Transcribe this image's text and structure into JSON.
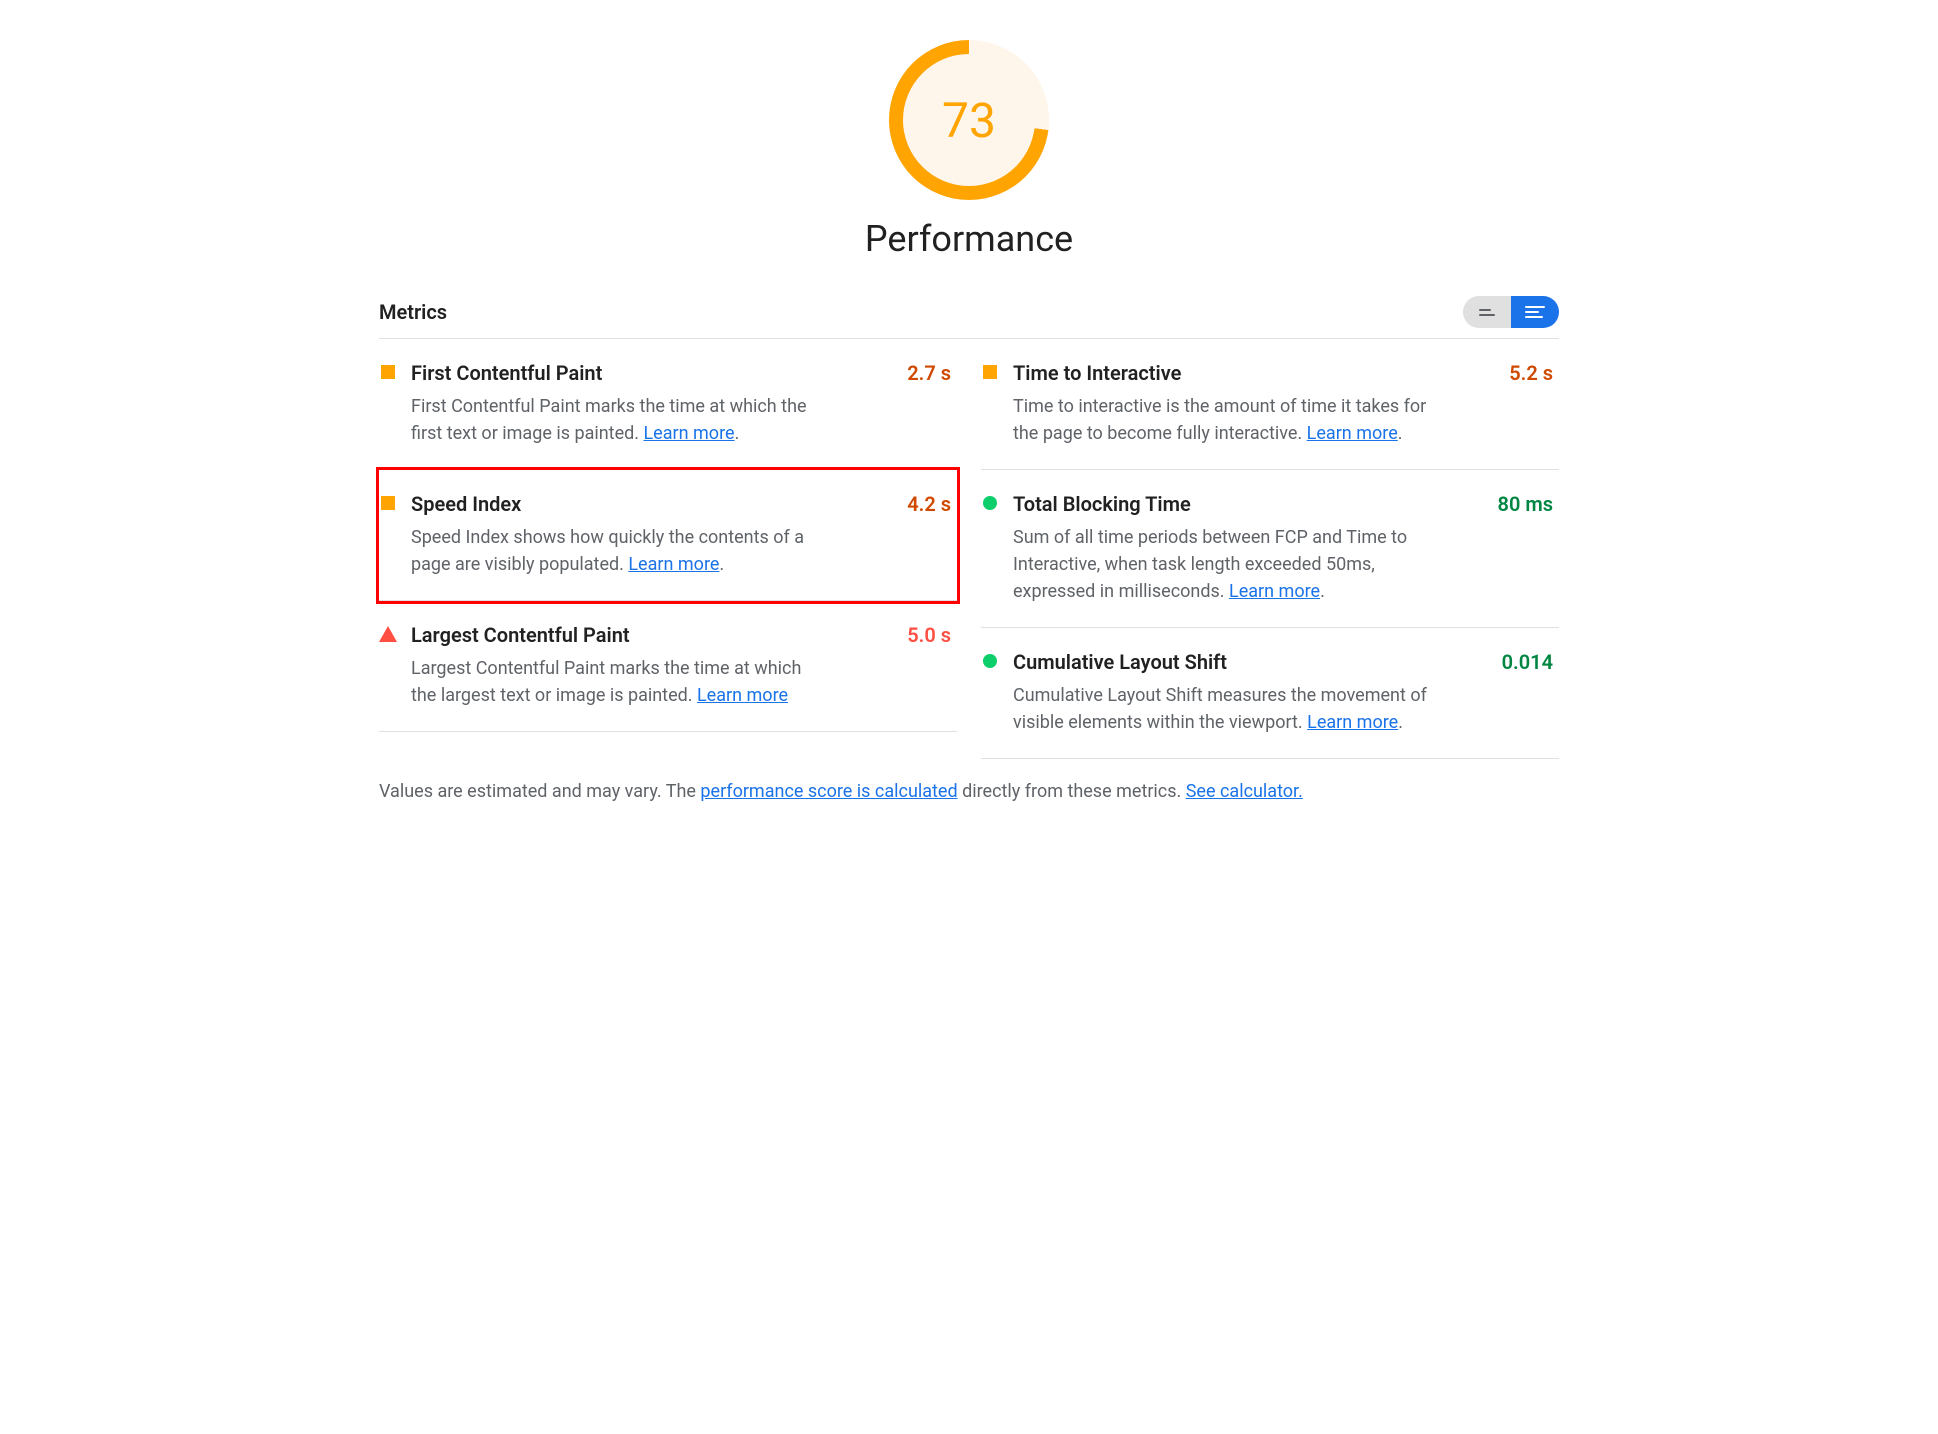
{
  "gauge": {
    "score": "73",
    "label": "Performance"
  },
  "sectionTitle": "Metrics",
  "metrics": {
    "left": [
      {
        "status": "average",
        "name": "First Contentful Paint",
        "value": "2.7 s",
        "valueClass": "v-orange",
        "desc": "First Contentful Paint marks the time at which the first text or image is painted. ",
        "learn": "Learn more",
        "afterLink": ".",
        "highlighted": false
      },
      {
        "status": "average",
        "name": "Speed Index",
        "value": "4.2 s",
        "valueClass": "v-orange",
        "desc": "Speed Index shows how quickly the contents of a page are visibly populated. ",
        "learn": "Learn more",
        "afterLink": ".",
        "highlighted": true
      },
      {
        "status": "fail",
        "name": "Largest Contentful Paint",
        "value": "5.0 s",
        "valueClass": "v-red",
        "desc": "Largest Contentful Paint marks the time at which the largest text or image is painted. ",
        "learn": "Learn more",
        "afterLink": "",
        "highlighted": false
      }
    ],
    "right": [
      {
        "status": "average",
        "name": "Time to Interactive",
        "value": "5.2 s",
        "valueClass": "v-orange",
        "desc": "Time to interactive is the amount of time it takes for the page to become fully interactive. ",
        "learn": "Learn more",
        "afterLink": ".",
        "highlighted": false
      },
      {
        "status": "pass",
        "name": "Total Blocking Time",
        "value": "80 ms",
        "valueClass": "v-green",
        "desc": "Sum of all time periods between FCP and Time to Interactive, when task length exceeded 50ms, expressed in milliseconds. ",
        "learn": "Learn more",
        "afterLink": ".",
        "highlighted": false
      },
      {
        "status": "pass",
        "name": "Cumulative Layout Shift",
        "value": "0.014",
        "valueClass": "v-green",
        "desc": "Cumulative Layout Shift measures the movement of visible elements within the viewport. ",
        "learn": "Learn more",
        "afterLink": ".",
        "highlighted": false
      }
    ]
  },
  "footer": {
    "pre": "Values are estimated and may vary. The ",
    "link1": "performance score is calculated",
    "mid": " directly from these metrics. ",
    "link2": "See calculator."
  }
}
